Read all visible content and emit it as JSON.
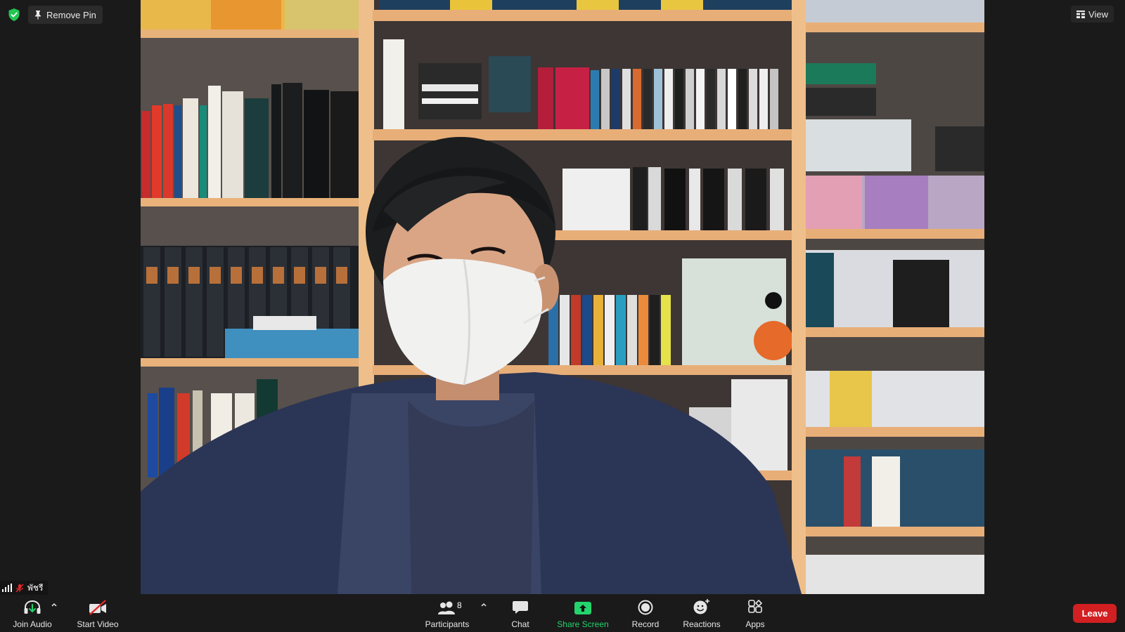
{
  "top_bar": {
    "pin_label": "Remove Pin",
    "view_label": "View"
  },
  "participant": {
    "name": "พัชรี"
  },
  "toolbar": {
    "join_audio": "Join Audio",
    "start_video": "Start Video",
    "participants": "Participants",
    "participants_count": "8",
    "chat": "Chat",
    "share_screen": "Share Screen",
    "record": "Record",
    "reactions": "Reactions",
    "apps": "Apps",
    "leave": "Leave"
  },
  "colors": {
    "background": "#1a1a1a",
    "share_green": "#24d36c",
    "leave_red": "#d21f21",
    "security_green": "#23c552"
  }
}
